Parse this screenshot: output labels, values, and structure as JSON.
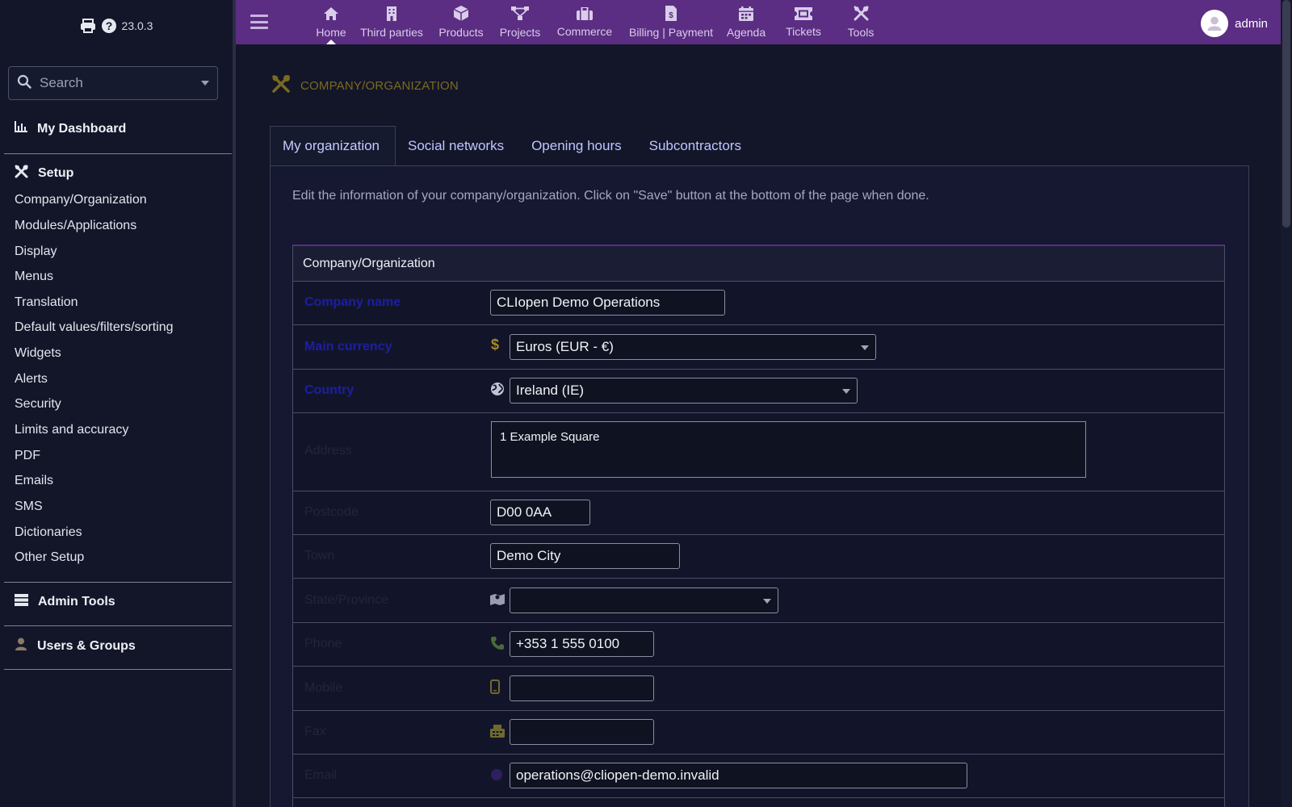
{
  "app": {
    "version": "23.0.3",
    "accent_color": "#5b2d83",
    "required_label_color": "#1c1fa0",
    "title_color": "#7a6a1e"
  },
  "sidebar": {
    "search": {
      "placeholder": "Search"
    },
    "sections": {
      "dashboard": {
        "label": "My Dashboard",
        "icon": "chart-icon"
      },
      "setup": {
        "label": "Setup",
        "icon": "tools-icon"
      },
      "admin_tools": {
        "label": "Admin Tools",
        "icon": "server-icon"
      },
      "users_groups": {
        "label": "Users & Groups",
        "icon": "user-icon"
      }
    },
    "setup_items": [
      "Company/Organization",
      "Modules/Applications",
      "Display",
      "Menus",
      "Translation",
      "Default values/filters/sorting",
      "Widgets",
      "Alerts",
      "Security",
      "Limits and accuracy",
      "PDF",
      "Emails",
      "SMS",
      "Dictionaries",
      "Other Setup"
    ]
  },
  "topnav": {
    "active": "Home",
    "items": [
      {
        "label": "Home",
        "icon": "home-icon"
      },
      {
        "label": "Third parties",
        "icon": "building-icon"
      },
      {
        "label": "Products",
        "icon": "cube-icon"
      },
      {
        "label": "Projects",
        "icon": "sitemap-icon"
      },
      {
        "label": "Commerce",
        "icon": "suitcase-icon"
      },
      {
        "label": "Billing | Payment",
        "icon": "invoice-icon"
      },
      {
        "label": "Agenda",
        "icon": "calendar-icon"
      },
      {
        "label": "Tickets",
        "icon": "ticket-icon"
      },
      {
        "label": "Tools",
        "icon": "tools-icon"
      }
    ],
    "user": "admin"
  },
  "page": {
    "title": "COMPANY/ORGANIZATION",
    "tabs": [
      "My organization",
      "Social networks",
      "Opening hours",
      "Subcontractors"
    ],
    "active_tab": "My organization",
    "intro": "Edit the information of your company/organization. Click on \"Save\" button at the bottom of the page when done."
  },
  "form": {
    "heading": "Company/Organization",
    "fields": {
      "company_name": {
        "label": "Company name",
        "value": "CLIopen Demo Operations"
      },
      "currency": {
        "label": "Main currency",
        "value": "Euros (EUR - €)"
      },
      "country": {
        "label": "Country",
        "value": "Ireland (IE)"
      },
      "address": {
        "label": "Address",
        "value": "1 Example Square"
      },
      "zip": {
        "label": "Postcode",
        "value": "D00 0AA"
      },
      "town": {
        "label": "Town",
        "value": "Demo City"
      },
      "state": {
        "label": "State/Province",
        "value": ""
      },
      "phone": {
        "label": "Phone",
        "value": "+353 1 555 0100"
      },
      "mobile": {
        "label": "Mobile",
        "value": ""
      },
      "fax": {
        "label": "Fax",
        "value": ""
      },
      "email": {
        "label": "Email",
        "value": "operations@cliopen-demo.invalid"
      }
    }
  }
}
